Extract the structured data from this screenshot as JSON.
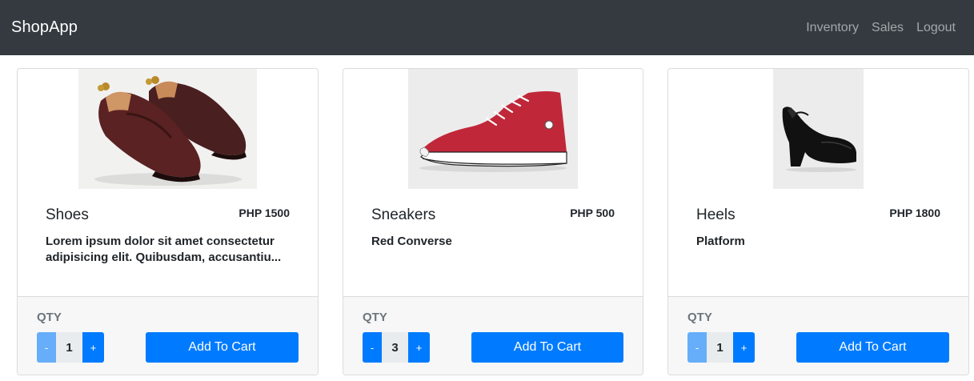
{
  "navbar": {
    "brand": "ShopApp",
    "links": [
      "Inventory",
      "Sales",
      "Logout"
    ]
  },
  "products": [
    {
      "image_icon": "loafer-shoes-icon",
      "name": "Shoes",
      "price": "PHP 1500",
      "description": "Lorem ipsum dolor sit amet consectetur adipisicing elit. Quibusdam, accusantiu...",
      "qty_label": "QTY",
      "qty": "1",
      "minus_label": "-",
      "plus_label": "+",
      "add_label": "Add To Cart"
    },
    {
      "image_icon": "red-sneaker-icon",
      "name": "Sneakers",
      "price": "PHP 500",
      "description": "Red Converse",
      "qty_label": "QTY",
      "qty": "3",
      "minus_label": "-",
      "plus_label": "+",
      "add_label": "Add To Cart"
    },
    {
      "image_icon": "black-heel-icon",
      "name": "Heels",
      "price": "PHP 1800",
      "description": "Platform",
      "qty_label": "QTY",
      "qty": "1",
      "minus_label": "-",
      "plus_label": "+",
      "add_label": "Add To Cart"
    }
  ],
  "colors": {
    "navbar_bg": "#343a40",
    "primary": "#007bff",
    "primary_disabled": "#66aef9",
    "footer_bg": "#f7f7f7",
    "muted": "#6c757d"
  }
}
